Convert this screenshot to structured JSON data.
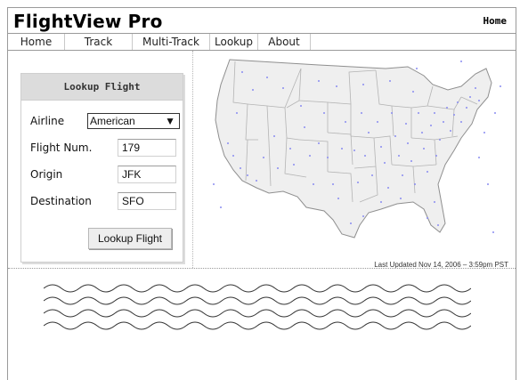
{
  "app": {
    "title": "FlightView Pro",
    "header_link": "Home"
  },
  "nav": {
    "tabs": [
      "Home",
      "Track",
      "Multi-Track",
      "Lookup",
      "About"
    ]
  },
  "lookup": {
    "title": "Lookup Flight",
    "airline_label": "Airline",
    "airline_value": "American",
    "flight_label": "Flight Num.",
    "flight_value": "179",
    "origin_label": "Origin",
    "origin_value": "JFK",
    "destination_label": "Destination",
    "destination_value": "SFO",
    "button_label": "Lookup Flight"
  },
  "map": {
    "last_updated": "Last Updated Nov 14, 2006 – 3:59pm PST",
    "dot_color": "#8a8cf0"
  }
}
